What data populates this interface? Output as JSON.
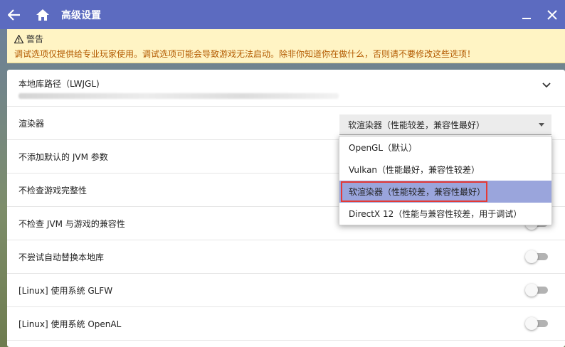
{
  "titlebar": {
    "title": "高级设置",
    "back_icon": "arrow-left-icon",
    "home_icon": "home-icon",
    "minimize_icon": "minimize-icon",
    "close_icon": "close-icon"
  },
  "warning": {
    "title": "警告",
    "message": "调试选项仅提供给专业玩家使用。调试选项可能会导致游戏无法启动。除非你知道你在做什么，否则请不要修改这些选项！"
  },
  "settings": {
    "native_lib": {
      "label": "本地库路径（LWJGL)"
    },
    "renderer": {
      "label": "渲染器",
      "selected": "软渲染器（性能较差，兼容性最好）"
    },
    "no_default_jvm_args": {
      "label": "不添加默认的 JVM 参数"
    },
    "no_game_check": {
      "label": "不检查游戏完整性"
    },
    "no_jvm_check": {
      "label": "不检查 JVM 与游戏的兼容性"
    },
    "no_native_replace": {
      "label": "不尝试自动替换本地库"
    },
    "system_glfw": {
      "label": "[Linux] 使用系统 GLFW"
    },
    "system_openal": {
      "label": "[Linux] 使用系统 OpenAL"
    }
  },
  "renderer_options": [
    "OpenGL（默认）",
    "Vulkan（性能最好，兼容性较差）",
    "软渲染器（性能较差，兼容性最好）",
    "DirectX 12（性能与兼容性较差，用于调试）"
  ],
  "colors": {
    "titlebar": "#5c6bc0",
    "warning_bg": "#fff4c4",
    "selected_option": "#9aa5dc",
    "highlight_border": "#e53935"
  }
}
